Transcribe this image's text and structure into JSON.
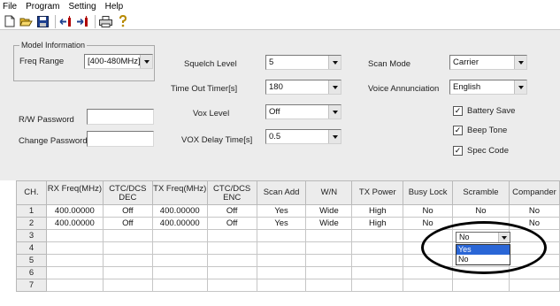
{
  "menu": [
    "File",
    "Program",
    "Setting",
    "Help"
  ],
  "toolbar": [
    {
      "name": "new-icon"
    },
    {
      "name": "open-icon"
    },
    {
      "name": "save-icon"
    },
    {
      "name": "read-from-radio-icon"
    },
    {
      "name": "write-to-radio-icon"
    },
    {
      "name": "print-icon"
    },
    {
      "name": "help-icon"
    }
  ],
  "model": {
    "legend": "Model Information",
    "freq_label": "Freq Range",
    "freq_value": "[400-480MHz]"
  },
  "rw_password": {
    "label": "R/W Password",
    "value": ""
  },
  "change_password": {
    "label": "Change Password",
    "value": ""
  },
  "squelch": {
    "label": "Squelch Level",
    "value": "5"
  },
  "tot": {
    "label": "Time Out Timer[s]",
    "value": "180"
  },
  "vox_level": {
    "label": "Vox Level",
    "value": "Off"
  },
  "vox_delay": {
    "label": "VOX Delay Time[s]",
    "value": "0.5"
  },
  "scan_mode": {
    "label": "Scan Mode",
    "value": "Carrier"
  },
  "voice": {
    "label": "Voice Annunciation",
    "value": "English"
  },
  "checks": [
    {
      "label": "Battery Save",
      "checked": true
    },
    {
      "label": "Beep Tone",
      "checked": true
    },
    {
      "label": "Spec Code",
      "checked": true
    }
  ],
  "grid": {
    "headers": [
      "CH.",
      "RX Freq(MHz)",
      "CTC/DCS DEC",
      "TX Freq(MHz)",
      "CTC/DCS ENC",
      "Scan Add",
      "W/N",
      "TX Power",
      "Busy Lock",
      "Scramble",
      "Compander"
    ],
    "rows": [
      [
        "1",
        "400.00000",
        "Off",
        "400.00000",
        "Off",
        "Yes",
        "Wide",
        "High",
        "No",
        "No",
        "No"
      ],
      [
        "2",
        "400.00000",
        "Off",
        "400.00000",
        "Off",
        "Yes",
        "Wide",
        "High",
        "No",
        "",
        "No"
      ],
      [
        "3",
        "",
        "",
        "",
        "",
        "",
        "",
        "",
        "",
        "",
        ""
      ],
      [
        "4",
        "",
        "",
        "",
        "",
        "",
        "",
        "",
        "",
        "",
        ""
      ],
      [
        "5",
        "",
        "",
        "",
        "",
        "",
        "",
        "",
        "",
        "",
        ""
      ],
      [
        "6",
        "",
        "",
        "",
        "",
        "",
        "",
        "",
        "",
        "",
        ""
      ],
      [
        "7",
        "",
        "",
        "",
        "",
        "",
        "",
        "",
        "",
        "",
        ""
      ]
    ]
  },
  "scramble_editor": {
    "value": "No",
    "options": [
      "Yes",
      "No"
    ],
    "highlighted": "Yes"
  },
  "colors": {
    "selection": "#2a66d6",
    "panel": "#ececec"
  }
}
